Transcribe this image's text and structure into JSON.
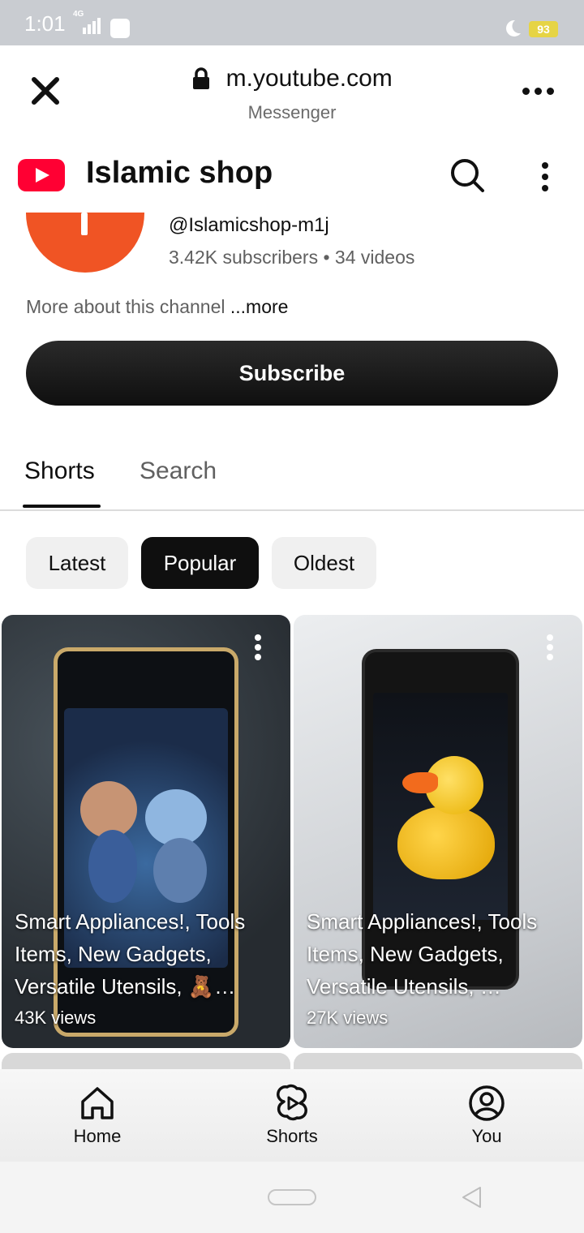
{
  "status_bar": {
    "time": "1:01",
    "network": "4G",
    "battery": "93"
  },
  "browser": {
    "url": "m.youtube.com",
    "subtitle": "Messenger"
  },
  "app_bar": {
    "title": "Islamic shop"
  },
  "channel": {
    "handle": "@Islamicshop-m1j",
    "stats": "3.42K subscribers • 34 videos",
    "about": "More about this channel ",
    "about_more": "...more",
    "subscribe_label": "Subscribe"
  },
  "tabs": [
    {
      "label": "Shorts",
      "active": true
    },
    {
      "label": "Search",
      "active": false
    }
  ],
  "chips": [
    {
      "label": "Latest",
      "selected": false
    },
    {
      "label": "Popular",
      "selected": true
    },
    {
      "label": "Oldest",
      "selected": false
    }
  ],
  "shorts": [
    {
      "title": "Smart Appliances!, Tools Items, New Gadgets, Versatile Utensils, 🧸…",
      "views": "43K views"
    },
    {
      "title": "Smart Appliances!, Tools Items, New Gadgets, Versatile Utensils, …",
      "views": "27K views"
    }
  ],
  "bottom_nav": [
    {
      "label": "Home",
      "icon": "home-icon"
    },
    {
      "label": "Shorts",
      "icon": "shorts-icon"
    },
    {
      "label": "You",
      "icon": "account-icon"
    }
  ],
  "colors": {
    "brand_red": "#ff0033",
    "avatar_orange": "#f05424",
    "chip_selected": "#0f0f0f"
  }
}
